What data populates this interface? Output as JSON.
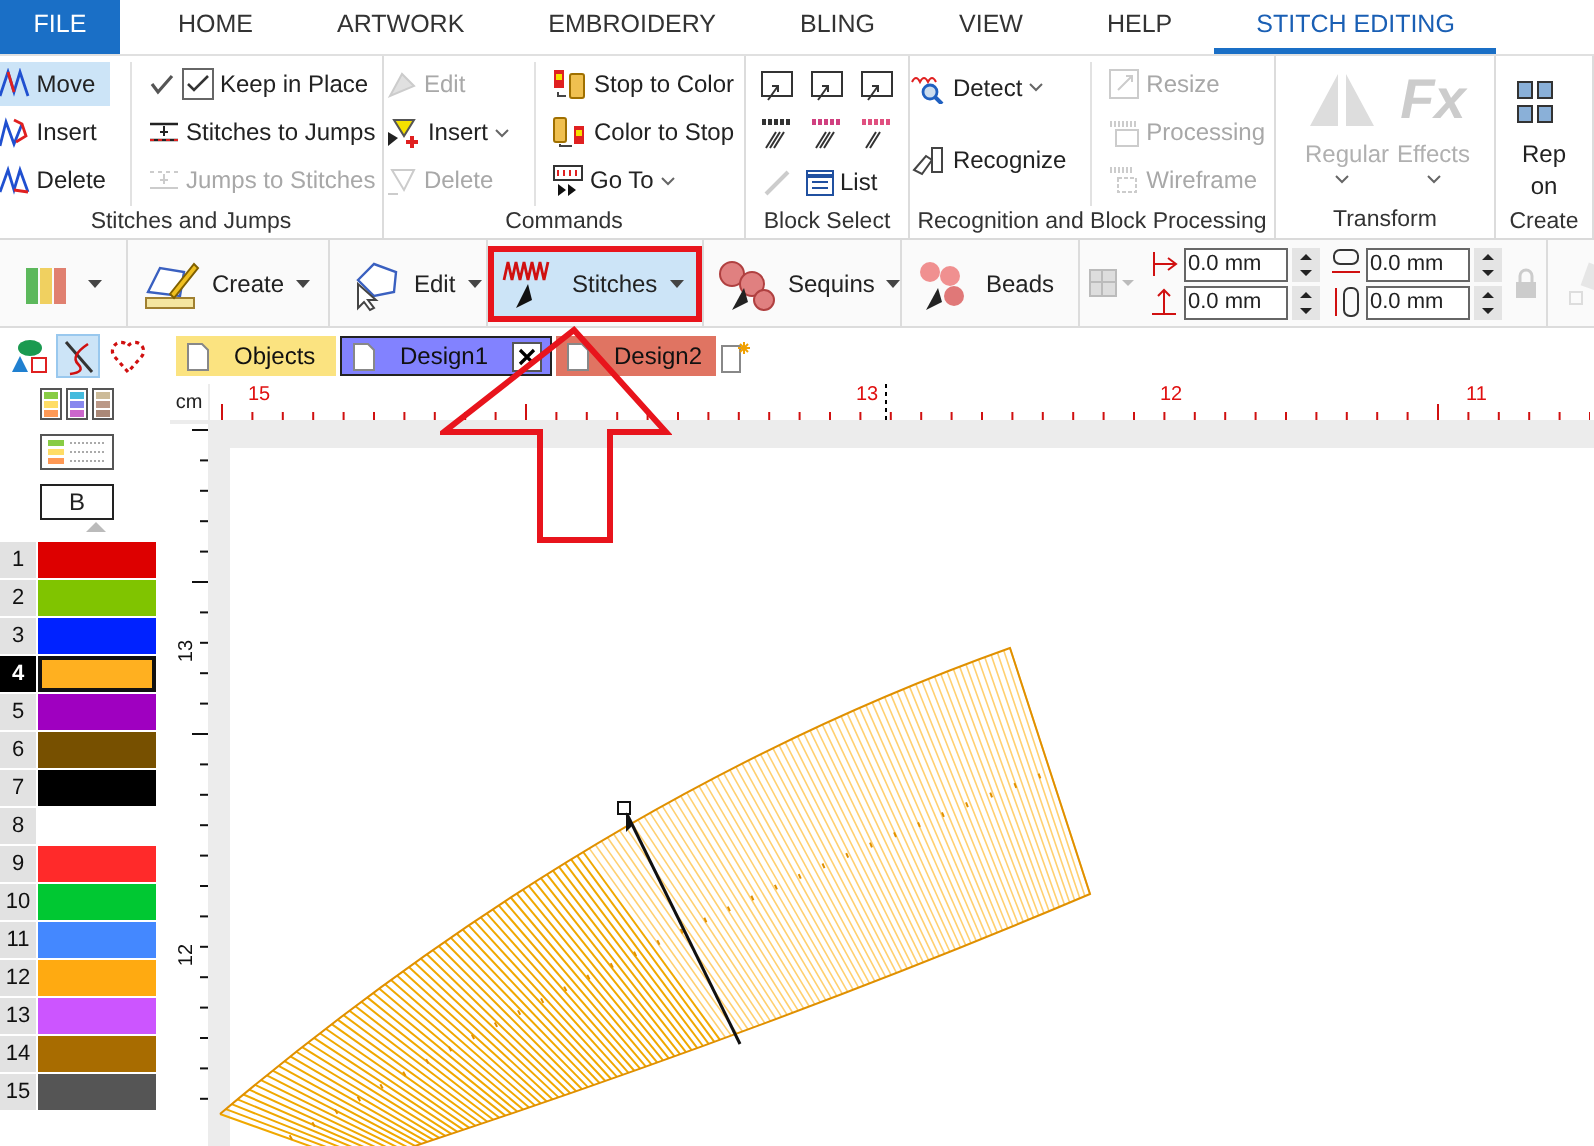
{
  "menu_tabs": [
    {
      "label": "FILE",
      "kind": "file",
      "selected": false
    },
    {
      "label": "HOME",
      "kind": "tab",
      "selected": false
    },
    {
      "label": "ARTWORK",
      "kind": "tab",
      "selected": false
    },
    {
      "label": "EMBROIDERY",
      "kind": "tab",
      "selected": false
    },
    {
      "label": "BLING",
      "kind": "tab",
      "selected": false
    },
    {
      "label": "VIEW",
      "kind": "tab",
      "selected": false
    },
    {
      "label": "HELP",
      "kind": "tab",
      "selected": false
    },
    {
      "label": "STITCH EDITING",
      "kind": "tab",
      "selected": true
    }
  ],
  "ribbon": {
    "groups": [
      {
        "kind": "stack",
        "label": "Stitches and Jumps",
        "columns": [
          [
            {
              "label": "Move",
              "selected": true,
              "disabled": false
            },
            {
              "label": "Insert",
              "selected": false,
              "disabled": false
            },
            {
              "label": "Delete",
              "selected": false,
              "disabled": false
            }
          ],
          [
            {
              "label": "Keep in Place",
              "checked": true,
              "disabled": false
            },
            {
              "label": "Stitches to Jumps",
              "disabled": false
            },
            {
              "label": "Jumps to Stitches",
              "disabled": true
            }
          ]
        ]
      },
      {
        "kind": "stack",
        "label": "Commands",
        "columns": [
          [
            {
              "label": "Edit",
              "disabled": true
            },
            {
              "label": "Insert",
              "disabled": false,
              "dropdown": true
            },
            {
              "label": "Delete",
              "disabled": true
            }
          ],
          [
            {
              "label": "Stop to Color",
              "disabled": false
            },
            {
              "label": "Color to Stop",
              "disabled": false
            },
            {
              "label": "Go To",
              "disabled": false,
              "dropdown": true
            }
          ]
        ]
      },
      {
        "kind": "blockselect",
        "label": "Block Select",
        "list_label": "List"
      },
      {
        "kind": "stack",
        "label": "Recognition and Block Processing",
        "columns": [
          [
            {
              "label": "Detect",
              "disabled": false,
              "dropdown": true
            },
            {
              "label": "Recognize",
              "disabled": false
            }
          ],
          [
            {
              "label": "Resize",
              "disabled": true
            },
            {
              "label": "Processing",
              "disabled": true
            },
            {
              "label": "Wireframe",
              "disabled": true
            }
          ]
        ]
      },
      {
        "kind": "large",
        "label": "Transform",
        "buttons": [
          {
            "label": "Regular",
            "disabled": true,
            "dropdown": true
          },
          {
            "label": "Effects",
            "glyph": "Fx",
            "disabled": true,
            "dropdown": true
          }
        ]
      },
      {
        "kind": "large",
        "label": "Create",
        "buttons": [
          {
            "label": "Rep on",
            "disabled": false,
            "dropdown": false
          }
        ]
      }
    ]
  },
  "toolbar": {
    "buttons": [
      {
        "label": "Create",
        "dropdown": true,
        "selected": false,
        "highlighted": false
      },
      {
        "label": "Edit",
        "dropdown": true,
        "selected": false,
        "highlighted": false
      },
      {
        "label": "Stitches",
        "dropdown": true,
        "selected": true,
        "highlighted": true
      },
      {
        "label": "Sequins",
        "dropdown": true,
        "selected": false,
        "highlighted": false
      },
      {
        "label": "Beads",
        "dropdown": false,
        "selected": false,
        "highlighted": false
      }
    ],
    "fields": [
      {
        "value": "0.0 mm"
      },
      {
        "value": "0.0 mm"
      },
      {
        "value": "0.0 mm"
      },
      {
        "value": "0.0 mm"
      }
    ]
  },
  "doc_tabs": [
    {
      "label": "Objects",
      "color": "#fbe380",
      "selected": false,
      "closable": false
    },
    {
      "label": "Design1",
      "color": "#8282ff",
      "selected": true,
      "closable": true
    },
    {
      "label": "Design2",
      "color": "#e07462",
      "selected": false,
      "closable": false
    }
  ],
  "left_panel": {
    "tools": [
      {
        "selected": false
      },
      {
        "selected": true
      },
      {
        "selected": false
      }
    ],
    "block_label": "B",
    "colors": [
      {
        "number": "1",
        "color": "#dd0000",
        "selected": false
      },
      {
        "number": "2",
        "color": "#80c400",
        "selected": false
      },
      {
        "number": "3",
        "color": "#0022ff",
        "selected": false
      },
      {
        "number": "4",
        "color": "#ffb020",
        "selected": true
      },
      {
        "number": "5",
        "color": "#9f00c0",
        "selected": false
      },
      {
        "number": "6",
        "color": "#775000",
        "selected": false
      },
      {
        "number": "7",
        "color": "#000000",
        "selected": false
      },
      {
        "number": "8",
        "selected": false
      },
      {
        "number": "9",
        "color": "#ff2a2a",
        "selected": false
      },
      {
        "number": "10",
        "color": "#00c832",
        "selected": false
      },
      {
        "number": "11",
        "color": "#4488ff",
        "selected": false
      },
      {
        "number": "12",
        "color": "#ffaa11",
        "selected": false
      },
      {
        "number": "13",
        "color": "#cc55ff",
        "selected": false
      },
      {
        "number": "14",
        "color": "#a86c00",
        "selected": false
      },
      {
        "number": "15",
        "color": "#555555",
        "selected": false
      }
    ]
  },
  "ruler": {
    "unit": "cm",
    "x_labels": [
      "15",
      "13",
      "12",
      "11"
    ],
    "y_labels": [
      "13",
      "12"
    ]
  }
}
